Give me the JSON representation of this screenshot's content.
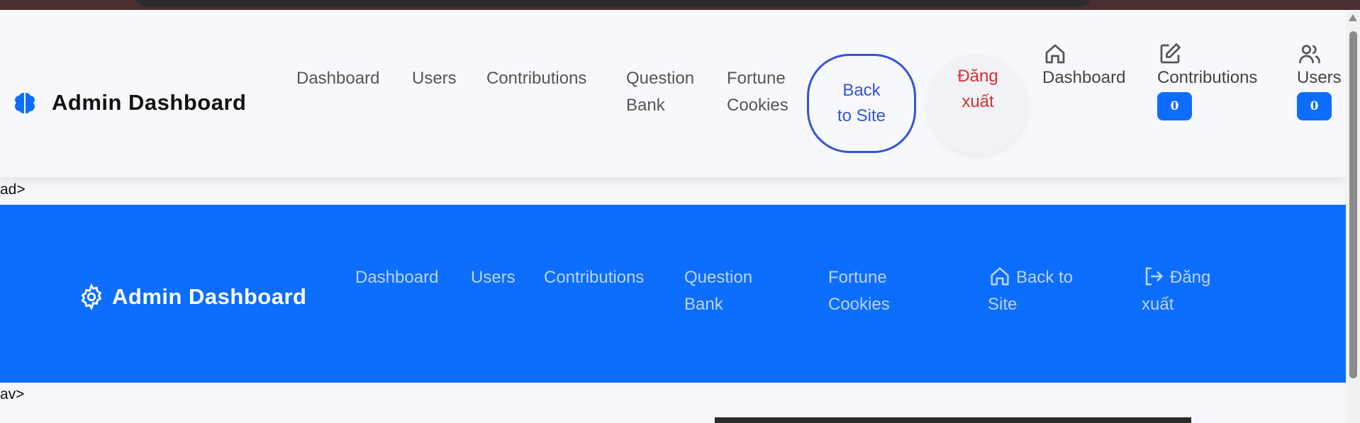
{
  "header1": {
    "brand": {
      "icon": "brain-icon",
      "title": "Admin Dashboard"
    },
    "nav": [
      {
        "label": "Dashboard"
      },
      {
        "label": "Users"
      },
      {
        "label": "Contributions"
      },
      {
        "label": "Question Bank"
      },
      {
        "label": "Fortune Cookies"
      }
    ],
    "back_button": "Back to Site",
    "logout_button": "Đăng xuất",
    "icon_links": [
      {
        "icon": "home-icon",
        "label": "Dashboard"
      },
      {
        "icon": "edit-icon",
        "label": "Contributions",
        "badge": "0"
      },
      {
        "icon": "users-icon",
        "label": "Users",
        "badge": "0"
      }
    ]
  },
  "stray_text": {
    "after_header": "ad>",
    "after_nav": "av>"
  },
  "header2": {
    "brand": {
      "icon": "gear-icon",
      "title": "Admin Dashboard"
    },
    "nav": [
      {
        "label": "Dashboard"
      },
      {
        "label": "Users"
      },
      {
        "label": "Contributions"
      },
      {
        "label": "Question Bank"
      },
      {
        "label": "Fortune Cookies"
      },
      {
        "label": "Back to Site",
        "icon": "home-icon"
      },
      {
        "label": "Đăng xuất",
        "icon": "logout-icon"
      }
    ]
  },
  "colors": {
    "primary": "#0d6efd",
    "danger": "#d82f35",
    "outline": "#3553d8"
  }
}
